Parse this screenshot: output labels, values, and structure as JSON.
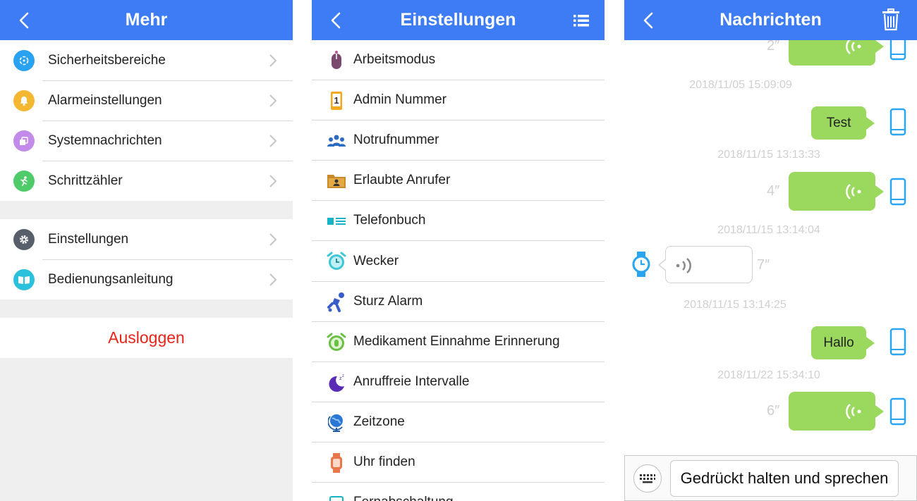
{
  "mehr": {
    "title": "Mehr",
    "group1": [
      {
        "label": "Sicherheitsbereiche",
        "icon": "safe-zone-icon",
        "color": "#2aa2f2"
      },
      {
        "label": "Alarmeinstellungen",
        "icon": "bell-icon",
        "color": "#f4b731"
      },
      {
        "label": "Systemnachrichten",
        "icon": "messages-icon",
        "color": "#c28bea"
      },
      {
        "label": "Schrittzähler",
        "icon": "runner-icon",
        "color": "#4fcb6a"
      }
    ],
    "group2": [
      {
        "label": "Einstellungen",
        "icon": "gear-icon",
        "color": "#595e6b"
      },
      {
        "label": "Bedienungsanleitung",
        "icon": "book-icon",
        "color": "#2ac1dc"
      }
    ],
    "logout": "Ausloggen"
  },
  "einstellungen": {
    "title": "Einstellungen",
    "items": [
      {
        "label": "Arbeitsmodus",
        "icon": "mouse-icon"
      },
      {
        "label": "Admin Nummer",
        "icon": "number-one-icon"
      },
      {
        "label": "Notrufnummer",
        "icon": "people-icon"
      },
      {
        "label": "Erlaubte Anrufer",
        "icon": "contact-folder-icon"
      },
      {
        "label": "Telefonbuch",
        "icon": "phonebook-icon"
      },
      {
        "label": "Wecker",
        "icon": "alarm-clock-icon"
      },
      {
        "label": "Sturz Alarm",
        "icon": "fall-icon"
      },
      {
        "label": "Medikament Einnahme Erinnerung",
        "icon": "medicine-alarm-icon"
      },
      {
        "label": "Anruffreie Intervalle",
        "icon": "moon-icon"
      },
      {
        "label": "Zeitzone",
        "icon": "globe-icon"
      },
      {
        "label": "Uhr finden",
        "icon": "watch-icon"
      },
      {
        "label": "Fernabschaltung",
        "icon": "remote-off-icon"
      }
    ]
  },
  "nachrichten": {
    "title": "Nachrichten",
    "top_timestamp": "Nachrichten",
    "msg1_duration": "2″",
    "ts1": "2018/11/05 15:09:09",
    "msg2_text": "Test",
    "ts2": "2018/11/15 13:13:33",
    "msg3_duration": "4″",
    "ts3": "2018/11/15 13:14:04",
    "msg4_duration": "7″",
    "ts4": "2018/11/15 13:14:25",
    "msg5_text": "Hallo",
    "ts5": "2018/11/22 15:34:10",
    "msg6_duration": "6″",
    "talk_button": "Gedrückt halten und sprechen"
  },
  "colors": {
    "header": "#3d7cf4",
    "bubble_green": "#9bd95e",
    "logout_red": "#e8231a",
    "phone_blue": "#2aa6f0"
  }
}
